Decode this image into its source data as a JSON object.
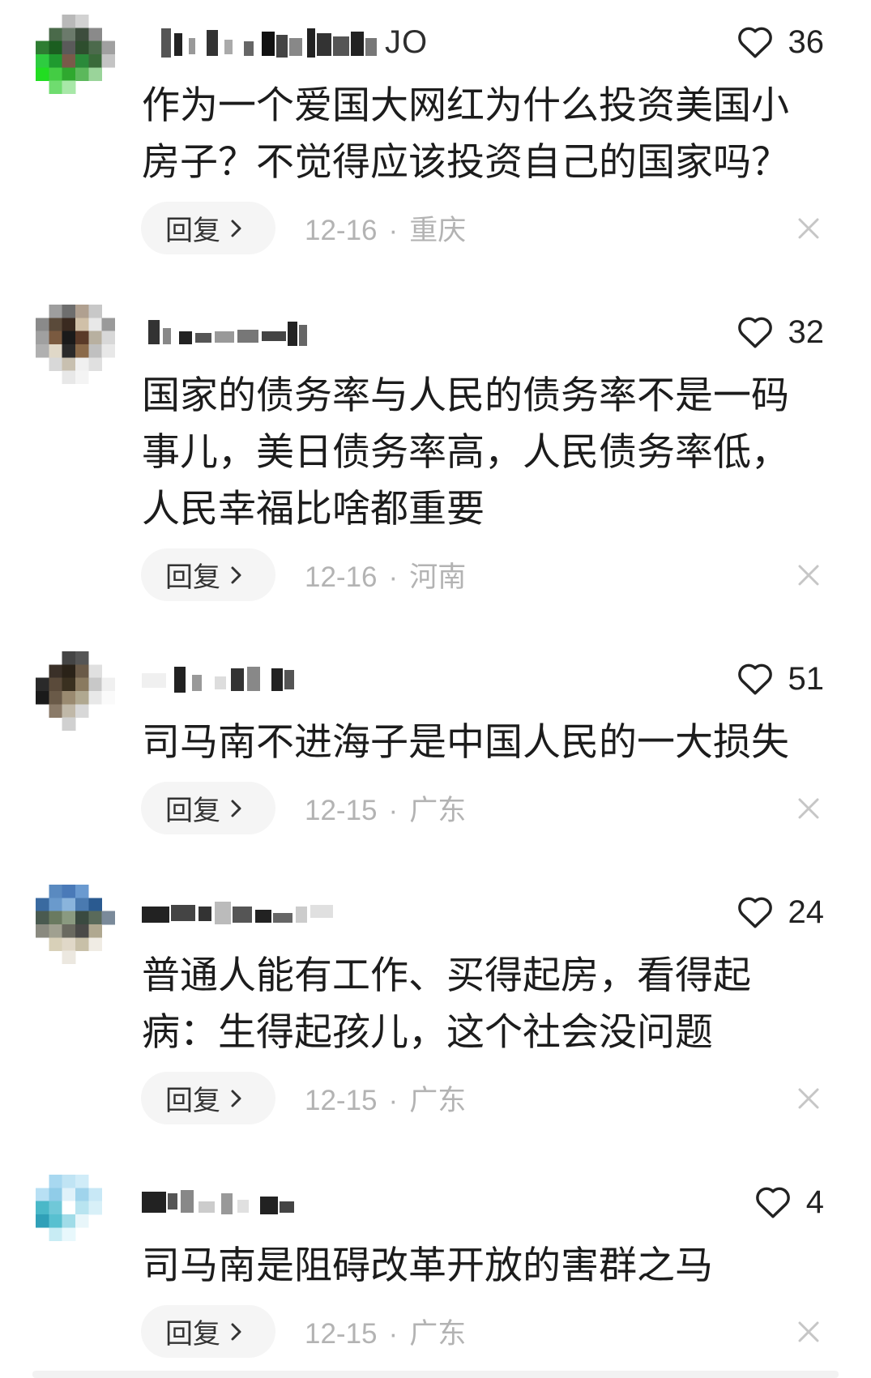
{
  "reply_label": "回复",
  "meta_separator": "·",
  "icons": {
    "like": "heart-outline-icon",
    "reply": "chevron-right-icon",
    "dismiss": "close-icon"
  },
  "colors": {
    "text": "#1c1c1c",
    "meta": "#b3b3b3",
    "reply_pill_bg": "#f5f5f5"
  },
  "comments": [
    {
      "username_visible": "JO",
      "likes": 36,
      "lines": [
        "作为一个爱国大网红为什么投资美国小",
        "房子？不觉得应该投资自己的国家吗？"
      ],
      "date": "12-16",
      "location": "重庆"
    },
    {
      "likes": 32,
      "lines": [
        "国家的债务率与人民的债务率不是一码",
        "事儿，美日债务率高，人民债务率低，",
        "人民幸福比啥都重要"
      ],
      "date": "12-16",
      "location": "河南"
    },
    {
      "likes": 51,
      "lines": [
        "司马南不进海子是中国人民的一大损失"
      ],
      "date": "12-15",
      "location": "广东"
    },
    {
      "likes": 24,
      "lines": [
        "普通人能有工作、买得起房，看得起",
        "病：生得起孩儿，这个社会没问题"
      ],
      "date": "12-15",
      "location": "广东"
    },
    {
      "likes": 4,
      "lines": [
        "司马南是阻碍改革开放的害群之马"
      ],
      "date": "12-15",
      "location": "广东"
    }
  ]
}
